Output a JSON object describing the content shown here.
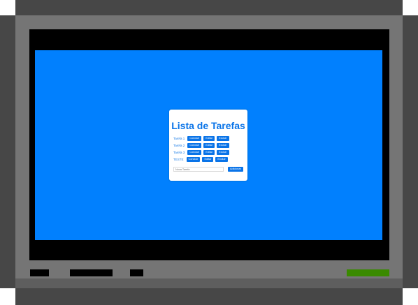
{
  "app": {
    "title": "Lista de Tarefas"
  },
  "tasks": [
    {
      "label": "Tarefa 1",
      "actions": [
        "Concluir",
        "Editar",
        "Excluir"
      ]
    },
    {
      "label": "Tarefa 2",
      "actions": [
        "Concluir",
        "Editar",
        "Excluir"
      ]
    },
    {
      "label": "Tarefa 3",
      "actions": [
        "Concluir",
        "Editar",
        "Excluir"
      ]
    },
    {
      "label": "TESTE",
      "actions": [
        "Concluir",
        "Editar",
        "Excluir"
      ]
    }
  ],
  "new_task": {
    "placeholder": "Nova Tarefa",
    "add_label": "Adicionar"
  },
  "colors": {
    "screen_background": "#0180fe",
    "accent": "#0a74e8",
    "status_light": "#3a8a00"
  }
}
